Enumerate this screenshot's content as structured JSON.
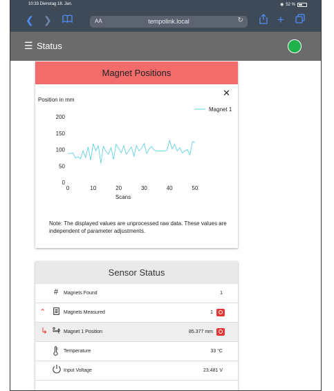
{
  "status_bar": {
    "time": "10:33 Dienstag 18. Jan.",
    "battery": "52 %",
    "battery_level": 0.52
  },
  "browser": {
    "text_size_label": "AA",
    "url": "tempolink.local"
  },
  "app": {
    "title": "Status",
    "connection_color": "#1db24a"
  },
  "magnet_card": {
    "title": "Magnet Positions",
    "note": "Note: The displayed values are unprocessed raw data. These values are independent of parameter adjustments."
  },
  "chart_data": {
    "type": "line",
    "title": "Position in mm",
    "xlabel": "Scans",
    "ylabel": "",
    "xlim": [
      0,
      50
    ],
    "ylim": [
      0,
      200
    ],
    "xticks": [
      "0",
      "10",
      "20",
      "30",
      "40",
      "50"
    ],
    "yticks": [
      "0",
      "50",
      "100",
      "150",
      "200"
    ],
    "legend_position": "top-right",
    "series": [
      {
        "name": "Magnet 1",
        "color": "#5fd3e0",
        "x": [
          0,
          1,
          2,
          3,
          4,
          5,
          6,
          7,
          8,
          9,
          10,
          11,
          12,
          13,
          14,
          15,
          16,
          17,
          18,
          19,
          20,
          21,
          22,
          23,
          24,
          25,
          26,
          27,
          28,
          29,
          30,
          31,
          32,
          33,
          34,
          35,
          36,
          37,
          38,
          39,
          40,
          41,
          42,
          43,
          44,
          45,
          46,
          47,
          48,
          49,
          50
        ],
        "y": [
          88,
          88,
          90,
          74,
          78,
          72,
          96,
          76,
          108,
          68,
          118,
          96,
          112,
          58,
          110,
          94,
          86,
          106,
          70,
          116,
          104,
          90,
          112,
          86,
          96,
          108,
          80,
          112,
          96,
          104,
          118,
          88,
          102,
          110,
          98,
          96,
          96,
          96,
          96,
          98,
          128,
          102,
          116,
          96,
          106,
          90,
          96,
          100,
          84,
          124,
          122
        ]
      }
    ]
  },
  "sensor_card": {
    "title": "Sensor Status",
    "rows": [
      {
        "label": "Magnets Found",
        "value": "1"
      },
      {
        "label": "Magnets Measured",
        "value": "1"
      },
      {
        "label": "Magnet 1 Position",
        "value": "85.377 mm"
      },
      {
        "label": "Temperature",
        "value": "33 °C"
      },
      {
        "label": "Input Voltage",
        "value": "23.481 V"
      }
    ]
  }
}
